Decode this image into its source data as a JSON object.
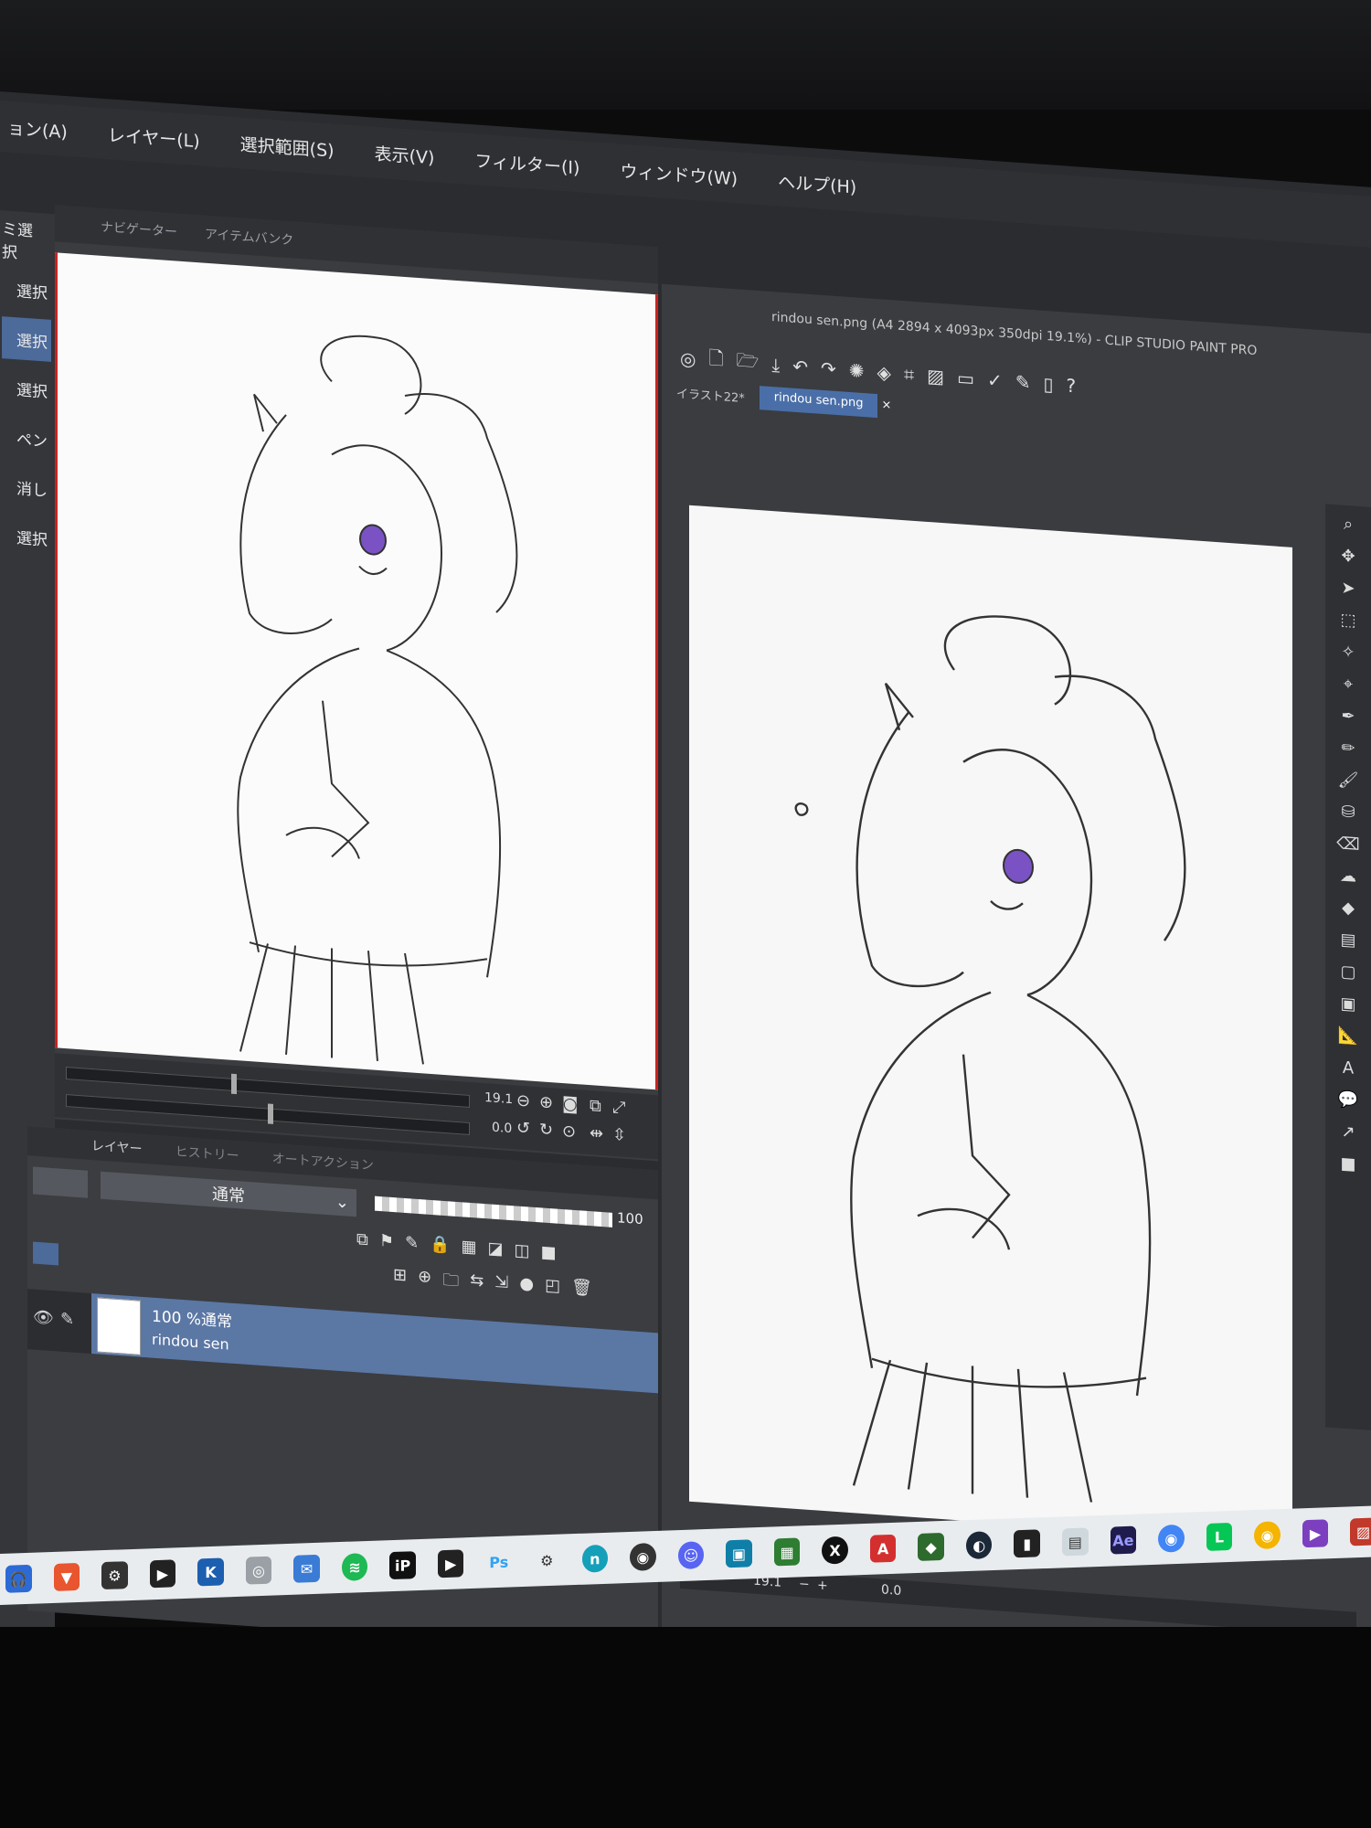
{
  "menubar": [
    "ョン(A)",
    "レイヤー(L)",
    "選択範囲(S)",
    "表示(V)",
    "フィルター(I)",
    "ウィンドウ(W)",
    "ヘルプ(H)"
  ],
  "left_tools": [
    "ミ選択",
    "選択",
    "選択",
    "選択",
    "ペン",
    "消し",
    "選択"
  ],
  "navigator": {
    "tabs": [
      "ナビゲーター",
      "アイテムバンク"
    ],
    "zoom": "19.1",
    "rotation": "0.0"
  },
  "layer_panel": {
    "tabs": [
      "レイヤー",
      "ヒストリー",
      "オートアクション"
    ],
    "blend_mode": "通常",
    "opacity": "100",
    "layer": {
      "mode": "100 %通常",
      "name": "rindou sen"
    }
  },
  "document": {
    "title": "rindou sen.png (A4 2894 x 4093px 350dpi 19.1%) - CLIP STUDIO PAINT PRO",
    "tabs": [
      "イラスト22*",
      "rindou sen.png"
    ],
    "status_zoom": "19.1",
    "status_rotation": "0.0"
  },
  "colors": {
    "selection": "#5b77a4",
    "tab_active": "#4a6fa8",
    "eye_iris": "#7a52c4",
    "guide_red": "#cc2222"
  },
  "taskbar_icons": [
    "headphones-icon",
    "brave-icon",
    "gear-icon",
    "video-icon",
    "k-icon",
    "swirl-icon",
    "mail-icon",
    "spotify-icon",
    "ip-icon",
    "play-icon",
    "ps-icon",
    "settings-icon",
    "nox-icon",
    "obs-icon",
    "discord-icon",
    "camera-icon",
    "minecraft-icon",
    "x-icon",
    "angular-icon",
    "app-icon",
    "steam-icon",
    "phone-icon",
    "sticky-icon",
    "ae-icon",
    "chrome-icon",
    "line-icon",
    "chrome-icon",
    "vs-icon",
    "box-icon"
  ]
}
